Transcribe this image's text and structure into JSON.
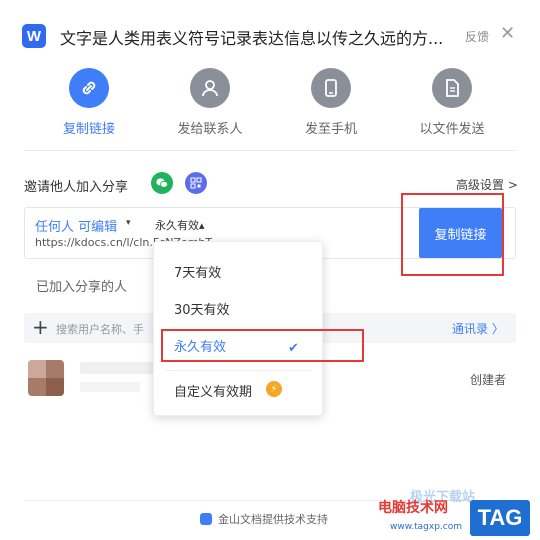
{
  "header": {
    "logo_letter": "W",
    "title": "文字是人类用表义符号记录表达信息以传之久远的方...",
    "feedback_label": "反馈",
    "close_symbol": "✕"
  },
  "share_tabs": [
    {
      "label": "复制链接",
      "icon": "link-icon",
      "active": true
    },
    {
      "label": "发给联系人",
      "icon": "person-icon",
      "active": false
    },
    {
      "label": "发至手机",
      "icon": "phone-icon",
      "active": false
    },
    {
      "label": "以文件发送",
      "icon": "file-icon",
      "active": false
    }
  ],
  "invite": {
    "label": "邀请他人加入分享",
    "advanced_settings": "高级设置 >"
  },
  "link": {
    "permission": "任何人 可编辑",
    "permission_caret": "▾",
    "expiry": "永久有效▴",
    "url": "https://kdocs.cn/l/cln.FcNZomhT",
    "copy_button": "复制链接"
  },
  "joined_label": "已加入分享的人",
  "search": {
    "plus": "+",
    "placeholder": "搜索用户名称、手",
    "contacts_link": "通讯录 〉"
  },
  "member": {
    "role": "创建者"
  },
  "expiry_dropdown": {
    "options": [
      "7天有效",
      "30天有效",
      "永久有效",
      "自定义有效期"
    ],
    "selected": "永久有效",
    "check": "✔",
    "bolt": "⚡"
  },
  "footer": {
    "text": "金山文档提供技术支持"
  },
  "watermark": {
    "site": "电脑技术网",
    "url": "www.tagxp.com",
    "tag": "TAG",
    "banner": "极光下载站"
  },
  "colors": {
    "accent": "#3f7ef6",
    "highlight_box": "#e53935"
  }
}
